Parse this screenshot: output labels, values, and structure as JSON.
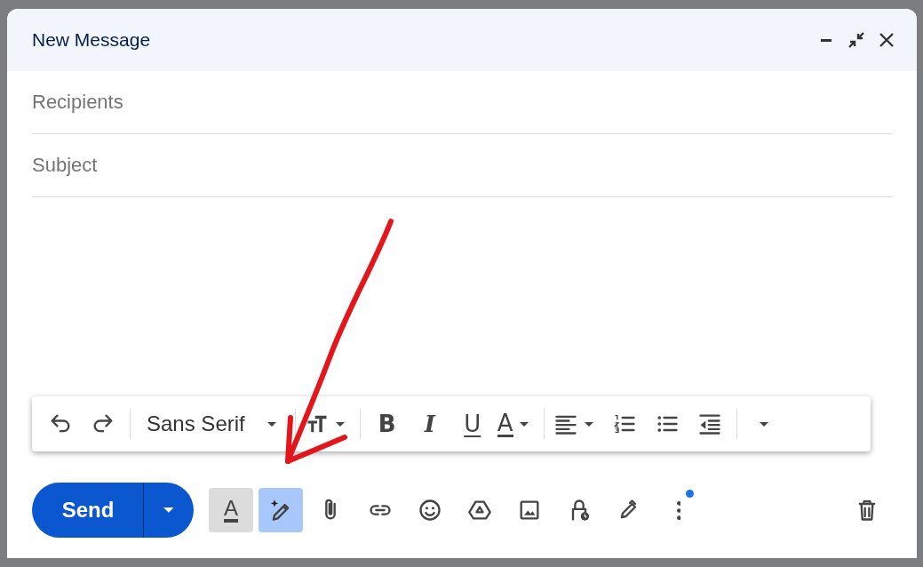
{
  "window": {
    "title": "New Message"
  },
  "fields": [
    {
      "placeholder": "Recipients"
    },
    {
      "placeholder": "Subject"
    }
  ],
  "format_toolbar": [
    {
      "kind": "undo"
    },
    {
      "kind": "redo"
    },
    {
      "kind": "divider"
    },
    {
      "kind": "font",
      "label": "Sans Serif"
    },
    {
      "kind": "divider"
    },
    {
      "kind": "text-size"
    },
    {
      "kind": "divider"
    },
    {
      "kind": "bold",
      "label": "B"
    },
    {
      "kind": "italic",
      "label": "I"
    },
    {
      "kind": "underline",
      "label": "U"
    },
    {
      "kind": "text-color",
      "label": "A"
    },
    {
      "kind": "divider"
    },
    {
      "kind": "align"
    },
    {
      "kind": "numbered-list"
    },
    {
      "kind": "bulleted-list"
    },
    {
      "kind": "indent-less"
    },
    {
      "kind": "divider"
    },
    {
      "kind": "more"
    }
  ],
  "send_button": {
    "label": "Send"
  },
  "action_bar": [
    {
      "kind": "formatting",
      "label": "A",
      "pressed": true,
      "highlighted": false
    },
    {
      "kind": "help-write",
      "pressed": false,
      "highlighted": true
    },
    {
      "kind": "attach",
      "pressed": false,
      "highlighted": false
    },
    {
      "kind": "link",
      "pressed": false,
      "highlighted": false
    },
    {
      "kind": "emoji",
      "pressed": false,
      "highlighted": false
    },
    {
      "kind": "drive",
      "pressed": false,
      "highlighted": false
    },
    {
      "kind": "photo",
      "pressed": false,
      "highlighted": false
    },
    {
      "kind": "confidential",
      "pressed": false,
      "highlighted": false
    },
    {
      "kind": "signature",
      "pressed": false,
      "highlighted": false
    },
    {
      "kind": "more-options",
      "pressed": false,
      "highlighted": false,
      "badge": true
    }
  ]
}
